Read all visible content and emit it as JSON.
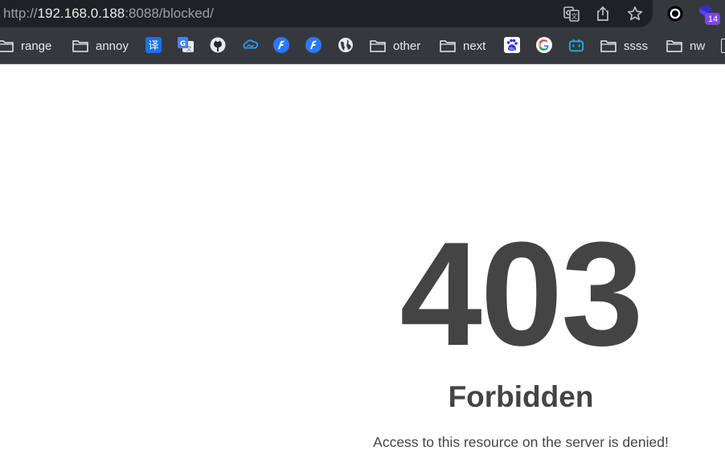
{
  "address_bar": {
    "scheme": "http://",
    "host": "192.168.0.188",
    "rest": ":8088/blocked/"
  },
  "toolbar": {
    "icons": [
      "translate-icon",
      "share-icon",
      "bookmark-star-icon",
      "extension-record-icon",
      "extension-badge-icon"
    ],
    "extension_badge_count": "14"
  },
  "bookmarks": {
    "folders": [
      {
        "label": "range"
      },
      {
        "label": "annoy"
      },
      {
        "label": "other"
      },
      {
        "label": "next"
      },
      {
        "label": "ssss"
      },
      {
        "label": "nw"
      }
    ],
    "favicons": [
      "translate-favicon",
      "google-translate-favicon",
      "github-favicon",
      "cloud-favicon",
      "app-favicon",
      "app-favicon",
      "globe-favicon",
      "baidu-favicon",
      "google-favicon",
      "bilibili-favicon"
    ]
  },
  "page": {
    "code": "403",
    "title": "Forbidden",
    "message": "Access to this resource on the server is denied!"
  },
  "colors": {
    "chrome_bg": "#35393e",
    "urlbar_bg": "#202124",
    "text_dark": "#444444"
  }
}
